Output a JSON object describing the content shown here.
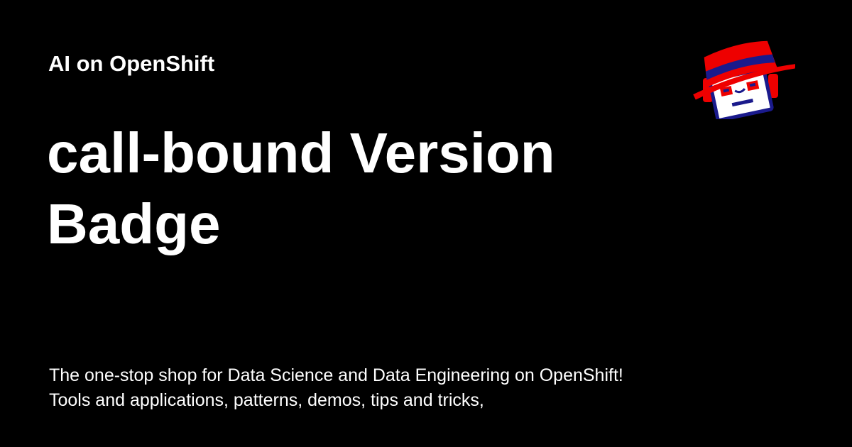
{
  "site": {
    "name": "AI on OpenShift"
  },
  "page": {
    "title": "call-bound Version Badge",
    "description": "The one-stop shop for Data Science and Data Engineering on OpenShift! Tools and applications, patterns, demos, tips and tricks,"
  },
  "logo": {
    "icon": "robot-with-red-hat-icon",
    "colors": {
      "hat": "#ee0000",
      "hat_band": "#1a1a8c",
      "face": "#ffffff",
      "eyes": "#ee0000",
      "outline": "#1a1a8c"
    }
  },
  "colors": {
    "background": "#000000",
    "text": "#ffffff"
  }
}
